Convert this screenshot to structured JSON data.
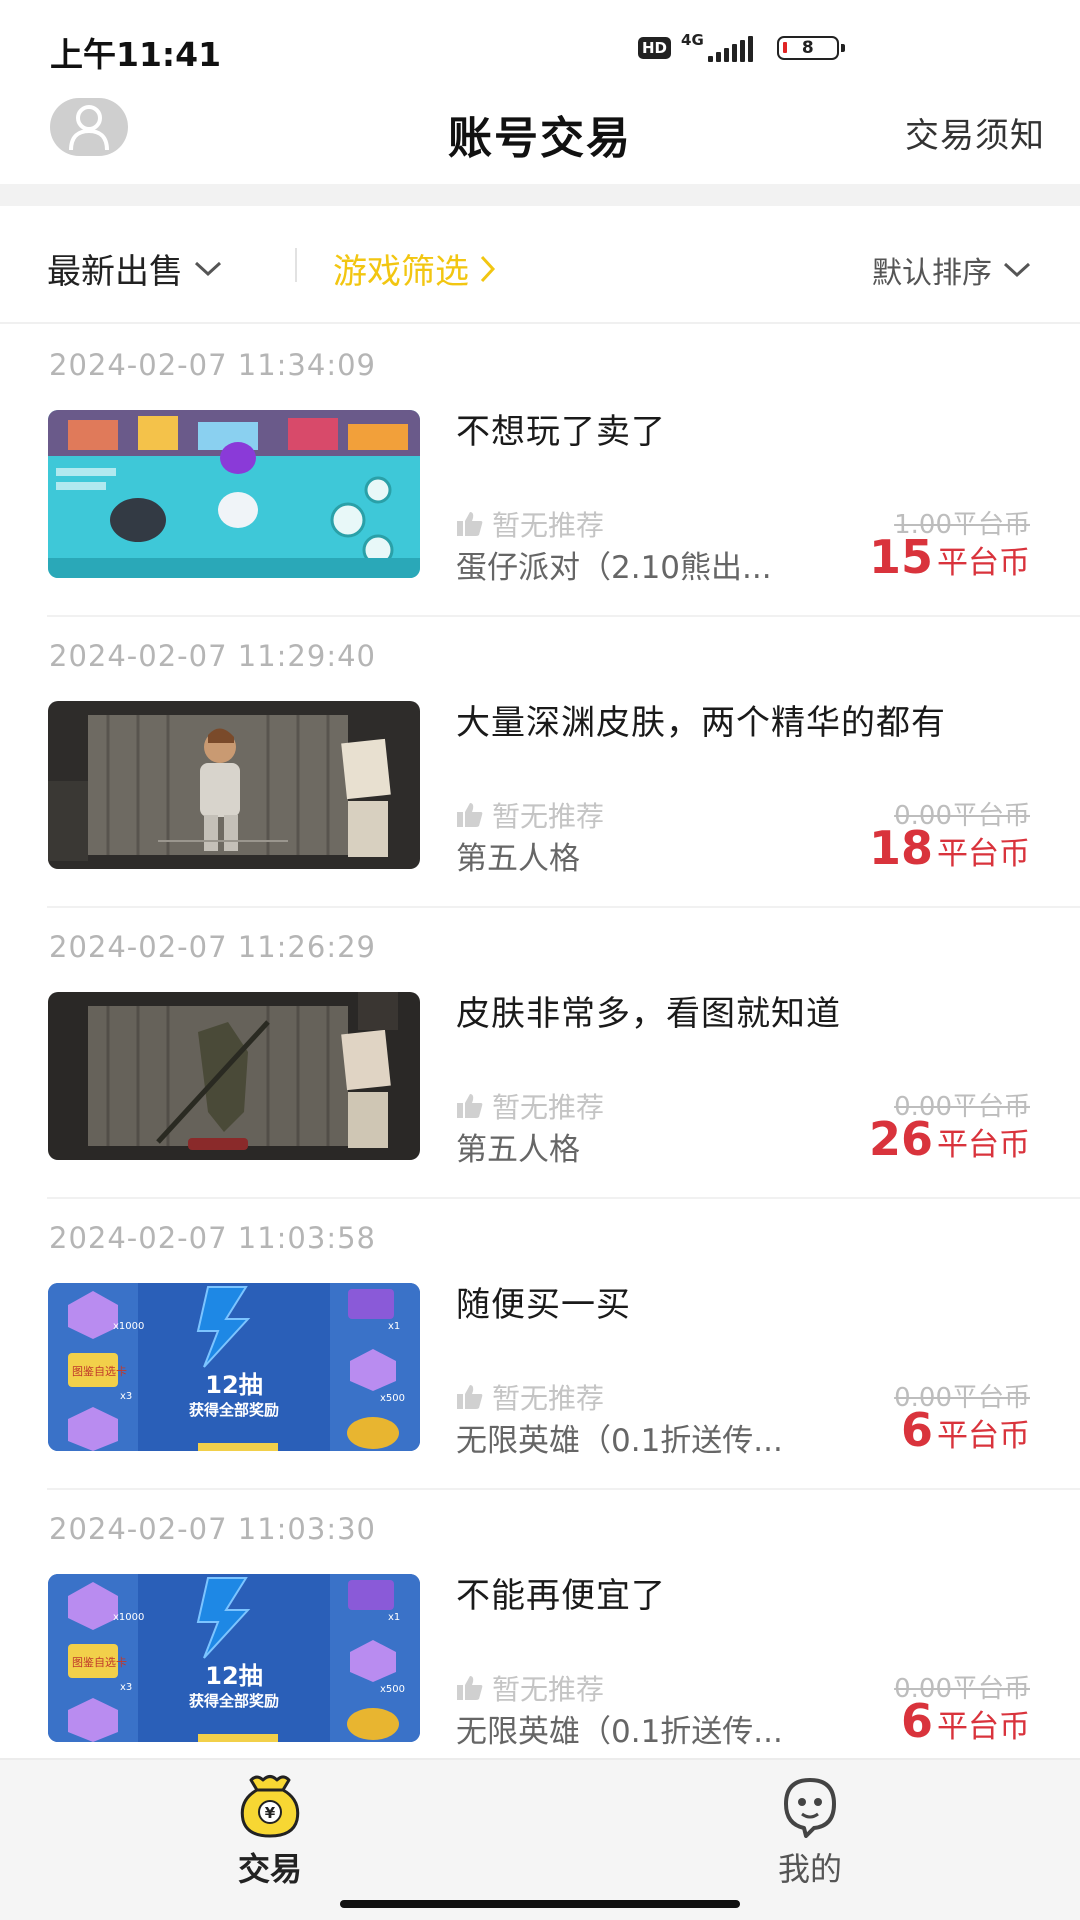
{
  "status_bar": {
    "time": "上午11:41",
    "hd": "HD",
    "network": "4G",
    "battery": "8"
  },
  "header": {
    "title": "账号交易",
    "rules_link": "交易须知",
    "avatar_icon": "user-avatar-icon"
  },
  "filters": {
    "latest_label": "最新出售",
    "game_filter_label": "游戏筛选",
    "sort_label": "默认排序"
  },
  "listings": [
    {
      "date": "2024-02-07 11:34:09",
      "title": "不想玩了卖了",
      "recommend": "暂无推荐",
      "game": "蛋仔派对（2.10熊出...",
      "original_price": "1.00平台币",
      "price": "15",
      "price_unit": "平台币"
    },
    {
      "date": "2024-02-07 11:29:40",
      "title": "大量深渊皮肤，两个精华的都有",
      "recommend": "暂无推荐",
      "game": "第五人格",
      "original_price": "0.00平台币",
      "price": "18",
      "price_unit": "平台币"
    },
    {
      "date": "2024-02-07 11:26:29",
      "title": "皮肤非常多，看图就知道",
      "recommend": "暂无推荐",
      "game": "第五人格",
      "original_price": "0.00平台币",
      "price": "26",
      "price_unit": "平台币"
    },
    {
      "date": "2024-02-07 11:03:58",
      "title": "随便买一买",
      "recommend": "暂无推荐",
      "game": "无限英雄（0.1折送传...",
      "original_price": "0.00平台币",
      "price": "6",
      "price_unit": "平台币"
    },
    {
      "date": "2024-02-07 11:03:30",
      "title": "不能再便宜了",
      "recommend": "暂无推荐",
      "game": "无限英雄（0.1折送传...",
      "original_price": "0.00平台币",
      "price": "6",
      "price_unit": "平台币"
    }
  ],
  "promo": {
    "draws": "12抽",
    "reward": "获得全部奖励",
    "card": "图鉴自选卡",
    "qty_1000": "x1000",
    "qty_1": "x1",
    "qty_3": "x3",
    "qty_500": "x500"
  },
  "bottom_nav": {
    "trade_label": "交易",
    "mine_label": "我的",
    "trade_icon": "money-bag-icon",
    "mine_icon": "chat-face-icon"
  },
  "colors": {
    "accent_yellow": "#f2c611",
    "price_red": "#d9333c"
  }
}
